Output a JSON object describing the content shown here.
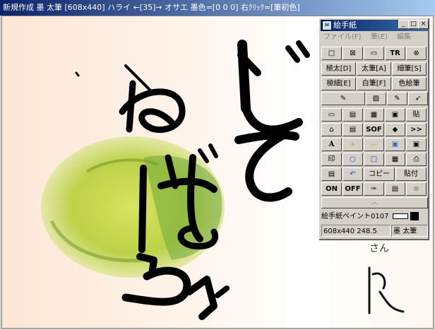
{
  "app": {
    "title": "新規作成 墨 太筆 [608x440] ハライ ←[35]→ オサエ 墨色=[0 0 0] 右ｸﾘｯｸ=[筆初色]"
  },
  "palette": {
    "title": "絵手紙",
    "window_buttons": [
      "_",
      "□",
      "×"
    ],
    "menu": [
      "ファイル(F)",
      "筆(E)",
      "編集"
    ],
    "row1": [
      "□",
      "⊠",
      "▭",
      "TR",
      "⊗"
    ],
    "row2": [
      "極太[D]",
      "太筆[A]",
      "細筆[S]"
    ],
    "row3": [
      "極細[E]",
      "白筆[F]",
      "色絵筆"
    ],
    "row4": [
      "✎",
      "▨",
      "✎",
      "➶"
    ],
    "row5": [
      "▭",
      "▤",
      "▦",
      "▣",
      "貼"
    ],
    "row6": [
      "⌂",
      "▤",
      "SOF",
      "◆",
      ">>"
    ],
    "row7": [
      "A",
      "+",
      "—",
      "▣",
      "▣"
    ],
    "row8": [
      "印",
      "○",
      "□",
      "▦",
      "⎙"
    ],
    "row9": [
      "▤",
      "↶",
      "コピー",
      "貼付"
    ],
    "row10": [
      "ON",
      "OFF",
      "✑",
      "▤",
      "⊗"
    ],
    "brush_name": "絵手紙ペイント0107",
    "size_info": "608x440 248.5",
    "brush_info": "墨 太筆",
    "accent": "#000000"
  },
  "canvas_text": {
    "side_text": "さん"
  }
}
